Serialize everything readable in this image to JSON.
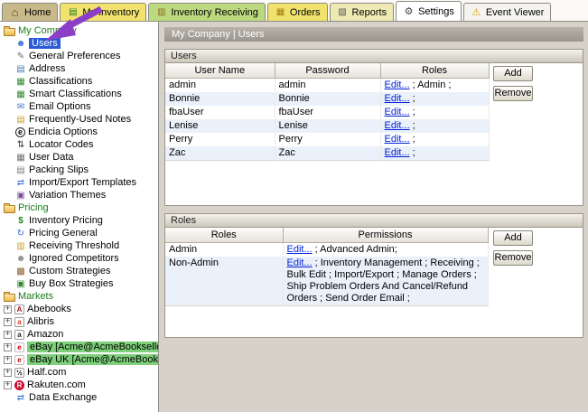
{
  "tabs": [
    {
      "label": "Home",
      "icon": "home-icon",
      "color": "#c7b98a"
    },
    {
      "label": "My Inventory",
      "icon": "inventory-book-icon",
      "color": "#f1e26e"
    },
    {
      "label": "Inventory Receiving",
      "icon": "receiving-box-icon",
      "color": "#bcd97f"
    },
    {
      "label": "Orders",
      "icon": "orders-icon",
      "color": "#f1e26e"
    },
    {
      "label": "Reports",
      "icon": "reports-icon",
      "color": "#efe9b4"
    },
    {
      "label": "Settings",
      "icon": "settings-gear-icon",
      "color": "#ffffff",
      "active": true
    },
    {
      "label": "Event Viewer",
      "icon": "warning-icon",
      "color": "#f5f4f0"
    }
  ],
  "sidebar": {
    "selection_color": "#2a5ad4",
    "sections": [
      {
        "label": "My Company",
        "icon": "folder-icon",
        "items": [
          {
            "label": "Users",
            "icon": "user-icon",
            "selected": true
          },
          {
            "label": "General Preferences",
            "icon": "preferences-icon"
          },
          {
            "label": "Address",
            "icon": "address-card-icon"
          },
          {
            "label": "Classifications",
            "icon": "classifications-icon"
          },
          {
            "label": "Smart Classifications",
            "icon": "smart-classifications-icon"
          },
          {
            "label": "Email Options",
            "icon": "email-icon"
          },
          {
            "label": "Frequently-Used Notes",
            "icon": "notes-icon"
          },
          {
            "label": "Endicia Options",
            "icon": "endicia-icon"
          },
          {
            "label": "Locator Codes",
            "icon": "locator-codes-icon"
          },
          {
            "label": "User Data",
            "icon": "user-data-icon"
          },
          {
            "label": "Packing Slips",
            "icon": "packing-slips-icon"
          },
          {
            "label": "Import/Export Templates",
            "icon": "import-export-icon"
          },
          {
            "label": "Variation Themes",
            "icon": "variation-themes-icon"
          }
        ]
      },
      {
        "label": "Pricing",
        "icon": "folder-icon",
        "items": [
          {
            "label": "Inventory Pricing",
            "icon": "dollar-icon"
          },
          {
            "label": "Pricing General",
            "icon": "pricing-general-icon"
          },
          {
            "label": "Receiving Threshold",
            "icon": "receiving-threshold-icon"
          },
          {
            "label": "Ignored Competitors",
            "icon": "ignored-competitors-icon"
          },
          {
            "label": "Custom Strategies",
            "icon": "custom-strategies-icon"
          },
          {
            "label": "Buy Box Strategies",
            "icon": "buy-box-icon"
          }
        ]
      },
      {
        "label": "Markets",
        "icon": "folder-icon",
        "items": [
          {
            "label": "Abebooks",
            "icon": "abebooks-icon",
            "expandable": true
          },
          {
            "label": "Alibris",
            "icon": "alibris-icon",
            "expandable": true
          },
          {
            "label": "Amazon",
            "icon": "amazon-icon",
            "expandable": true
          },
          {
            "label": "eBay [Acme@AcmeBookseller",
            "icon": "ebay-icon",
            "expandable": true,
            "highlight": "#7ed07a"
          },
          {
            "label": "eBay UK [Acme@AcmeBookse",
            "icon": "ebay-icon",
            "expandable": true,
            "highlight": "#7ed07a"
          },
          {
            "label": "Half.com",
            "icon": "half-com-icon",
            "expandable": true
          },
          {
            "label": "Rakuten.com",
            "icon": "rakuten-icon",
            "expandable": true
          },
          {
            "label": "Data Exchange",
            "icon": "data-exchange-icon"
          }
        ]
      }
    ]
  },
  "main": {
    "breadcrumb": "My Company | Users",
    "users_panel": {
      "title": "Users",
      "columns": [
        "User Name",
        "Password",
        "Roles"
      ],
      "add_label": "Add",
      "remove_label": "Remove",
      "rows": [
        {
          "user": "admin",
          "password": "admin",
          "edit": "Edit...",
          "roles": "; Admin ;"
        },
        {
          "user": "Bonnie",
          "password": "Bonnie",
          "edit": "Edit...",
          "roles": ";"
        },
        {
          "user": "fbaUser",
          "password": "fbaUser",
          "edit": "Edit...",
          "roles": ";"
        },
        {
          "user": "Lenise",
          "password": "Lenise",
          "edit": "Edit...",
          "roles": ";"
        },
        {
          "user": "Perry",
          "password": "Perry",
          "edit": "Edit...",
          "roles": ";"
        },
        {
          "user": "Zac",
          "password": "Zac",
          "edit": "Edit...",
          "roles": ";"
        }
      ]
    },
    "roles_panel": {
      "title": "Roles",
      "columns": [
        "Roles",
        "Permissions"
      ],
      "add_label": "Add",
      "remove_label": "Remove",
      "rows": [
        {
          "role": "Admin",
          "edit": "Edit...",
          "permissions": "; Advanced Admin;"
        },
        {
          "role": "Non-Admin",
          "edit": "Edit...",
          "permissions": "; Inventory Management ; Receiving ; Bulk Edit ; Import/Export ; Manage Orders ; Ship Problem Orders And Cancel/Refund Orders ; Send Order Email ;"
        }
      ]
    }
  },
  "annotation": {
    "type": "arrow",
    "color": "#8b3fc6"
  }
}
